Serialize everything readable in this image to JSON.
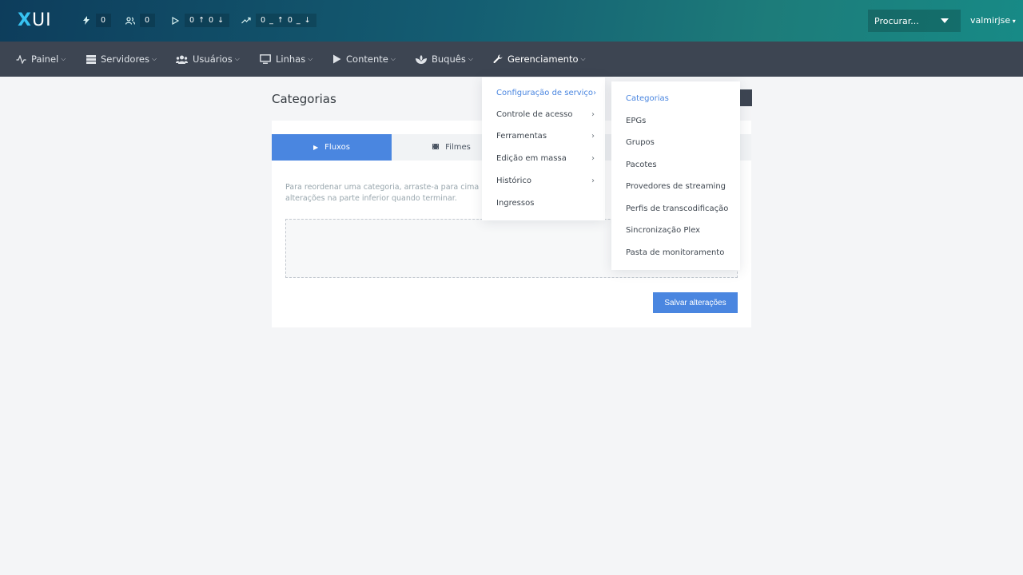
{
  "app": {
    "logo_x": "X",
    "logo_rest": "UI"
  },
  "topbar": {
    "stats": [
      {
        "icon": "bolt-icon",
        "value": "0"
      },
      {
        "icon": "users-icon",
        "value": "0"
      },
      {
        "icon": "play-icon",
        "value": "0 ↑ 0 ↓"
      },
      {
        "icon": "trend-icon",
        "value": "0 _ ↑  0 _ ↓"
      }
    ],
    "search_placeholder": "Procurar...",
    "username": "valmirjse"
  },
  "nav": {
    "items": [
      {
        "label": "Painel",
        "icon": "activity-icon"
      },
      {
        "label": "Servidores",
        "icon": "server-icon"
      },
      {
        "label": "Usuários",
        "icon": "users-icon"
      },
      {
        "label": "Linhas",
        "icon": "monitor-icon"
      },
      {
        "label": "Contente",
        "icon": "play-icon"
      },
      {
        "label": "Buquês",
        "icon": "bouquet-icon"
      },
      {
        "label": "Gerenciamento",
        "icon": "wrench-icon"
      }
    ]
  },
  "page": {
    "title": "Categorias",
    "tabs": [
      {
        "label": "Fluxos",
        "icon": "play-icon"
      },
      {
        "label": "Filmes",
        "icon": "film-icon"
      }
    ],
    "help_line1": "Para reordenar uma categoria, arraste-a para cima",
    "help_line2": "alterações na parte inferior quando terminar.",
    "save_label": "Salvar alterações"
  },
  "menu_management": {
    "items": [
      {
        "label": "Configuração de serviço",
        "arrow": "›"
      },
      {
        "label": "Controle de acesso",
        "arrow": "›"
      },
      {
        "label": "Ferramentas",
        "arrow": "›"
      },
      {
        "label": "Edição em massa",
        "arrow": "›"
      },
      {
        "label": "Histórico",
        "arrow": "›"
      },
      {
        "label": "Ingressos",
        "arrow": ""
      }
    ]
  },
  "menu_service": {
    "items": [
      {
        "label": "Categorias"
      },
      {
        "label": "EPGs"
      },
      {
        "label": "Grupos"
      },
      {
        "label": "Pacotes"
      },
      {
        "label": "Provedores de streaming"
      },
      {
        "label": "Perfis de transcodificação"
      },
      {
        "label": "Sincronização Plex"
      },
      {
        "label": "Pasta de monitoramento"
      }
    ]
  },
  "colors": {
    "accent": "#4a86e0",
    "navbar": "#3d4552",
    "topbar_start": "#0d3d5c",
    "topbar_end": "#178a86"
  }
}
